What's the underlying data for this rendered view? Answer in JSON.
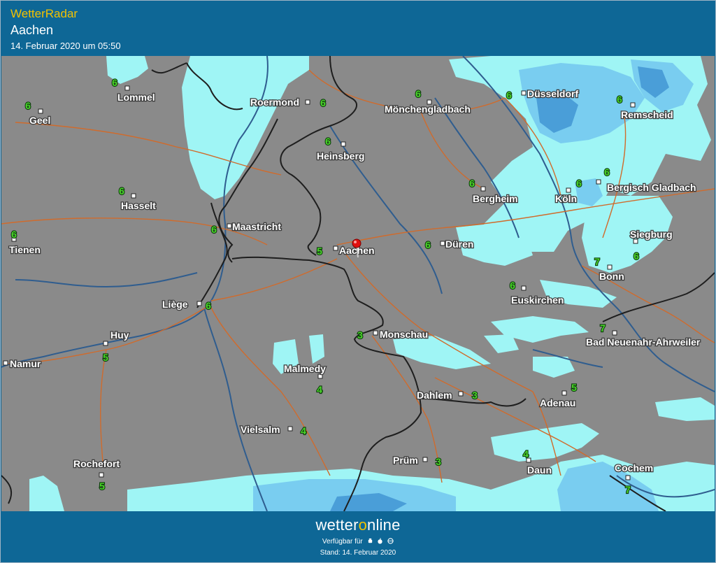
{
  "header": {
    "app_title": "WetterRadar",
    "location": "Aachen",
    "datetime": "14. Februar 2020 um 05:50"
  },
  "map": {
    "colors": {
      "land": "#8a8a8a",
      "rain_light": "#9ff5f5",
      "rain_medium": "#79cdf0",
      "rain_heavy": "#4a9ed8",
      "roads": "#d06b2c",
      "rivers": "#2f5d8f",
      "borders": "#202020",
      "temperature": "#4bd52a",
      "marker": "#e01010"
    },
    "marker": {
      "name": "Aachen",
      "icon": "location-pin-icon"
    },
    "cities": [
      {
        "name": "Lommel",
        "temp": "6"
      },
      {
        "name": "Geel",
        "temp": "6"
      },
      {
        "name": "Roermond",
        "temp": "6"
      },
      {
        "name": "Mönchengladbach",
        "temp": "6"
      },
      {
        "name": "Düsseldorf",
        "temp": "6"
      },
      {
        "name": "Remscheid",
        "temp": "6"
      },
      {
        "name": "Heinsberg",
        "temp": "6"
      },
      {
        "name": "Hasselt",
        "temp": "6"
      },
      {
        "name": "Bergheim",
        "temp": "6"
      },
      {
        "name": "Köln",
        "temp": "6"
      },
      {
        "name": "Bergisch Gladbach",
        "temp": "6"
      },
      {
        "name": "Tienen",
        "temp": "6"
      },
      {
        "name": "Maastricht",
        "temp": "6"
      },
      {
        "name": "Aachen",
        "temp": "5"
      },
      {
        "name": "Düren",
        "temp": "6"
      },
      {
        "name": "Siegburg",
        "temp": "6"
      },
      {
        "name": "Bonn",
        "temp": "7"
      },
      {
        "name": "Liège",
        "temp": "6"
      },
      {
        "name": "Euskirchen",
        "temp": "6"
      },
      {
        "name": "Huy",
        "temp": "5"
      },
      {
        "name": "Monschau",
        "temp": "3"
      },
      {
        "name": "Bad Neuenahr-Ahrweiler",
        "temp": "7"
      },
      {
        "name": "Namur",
        "temp": ""
      },
      {
        "name": "Malmedy",
        "temp": "4"
      },
      {
        "name": "Dahlem",
        "temp": "3"
      },
      {
        "name": "Adenau",
        "temp": "5"
      },
      {
        "name": "Vielsalm",
        "temp": "4"
      },
      {
        "name": "Rochefort",
        "temp": "5"
      },
      {
        "name": "Prüm",
        "temp": "3"
      },
      {
        "name": "Daun",
        "temp": "4"
      },
      {
        "name": "Cochem",
        "temp": "7"
      }
    ]
  },
  "footer": {
    "brand_prefix": "wetter",
    "brand_o": "o",
    "brand_suffix": "nline",
    "available": "Verfügbar für",
    "platform_icons": [
      "android-icon",
      "apple-icon",
      "web-icon"
    ],
    "stand": "Stand: 14. Februar 2020"
  }
}
